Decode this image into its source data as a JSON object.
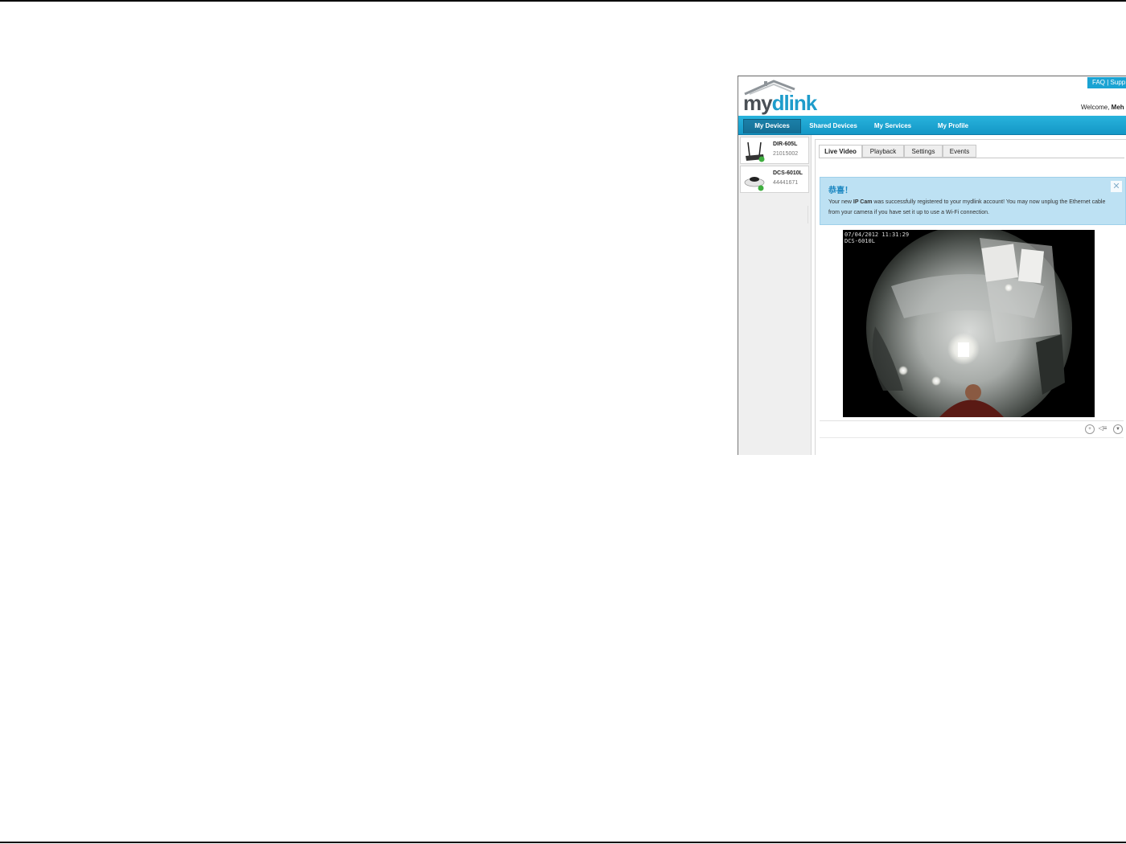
{
  "header": {
    "faq_label": "FAQ | Supp",
    "welcome_prefix": "Welcome,",
    "welcome_name": "Meh",
    "logo_my": "my",
    "logo_dlink": "dlink"
  },
  "nav": {
    "items": [
      {
        "label": "My Devices",
        "active": true
      },
      {
        "label": "Shared Devices",
        "active": false
      },
      {
        "label": "My Services",
        "active": false
      },
      {
        "label": "My Profile",
        "active": false
      }
    ]
  },
  "devices": [
    {
      "name": "DIR-605L",
      "id": "21015002",
      "icon": "router-icon",
      "status": "online-check-icon"
    },
    {
      "name": "DCS-6010L",
      "id": "44441671",
      "icon": "fisheye-camera-icon",
      "status": "online-check-icon"
    }
  ],
  "tabs": [
    {
      "label": "Live Video",
      "active": true
    },
    {
      "label": "Playback",
      "active": false
    },
    {
      "label": "Settings",
      "active": false
    },
    {
      "label": "Events",
      "active": false
    }
  ],
  "notice": {
    "title": "恭喜！",
    "text_before": "Your new ",
    "text_bold": "IP Cam",
    "text_after": " was successfully registered to your mydlink account! You may now unplug the Ethernet cable from your camera if you have set it up to use a Wi-Fi connection.",
    "close_icon": "close-icon"
  },
  "video": {
    "timestamp": "07/04/2012 11:31:29",
    "camera_label": "DCS-6010L"
  },
  "controls": {
    "zoom_icon": "zoom-in-icon",
    "audio_icon": "speaker-icon",
    "menu_icon": "dropdown-icon"
  },
  "colors": {
    "accent": "#1aa3d3",
    "nav_bg": "#1e9ccb",
    "notice_bg": "#bde1f3",
    "notice_title": "#1c87c1"
  }
}
